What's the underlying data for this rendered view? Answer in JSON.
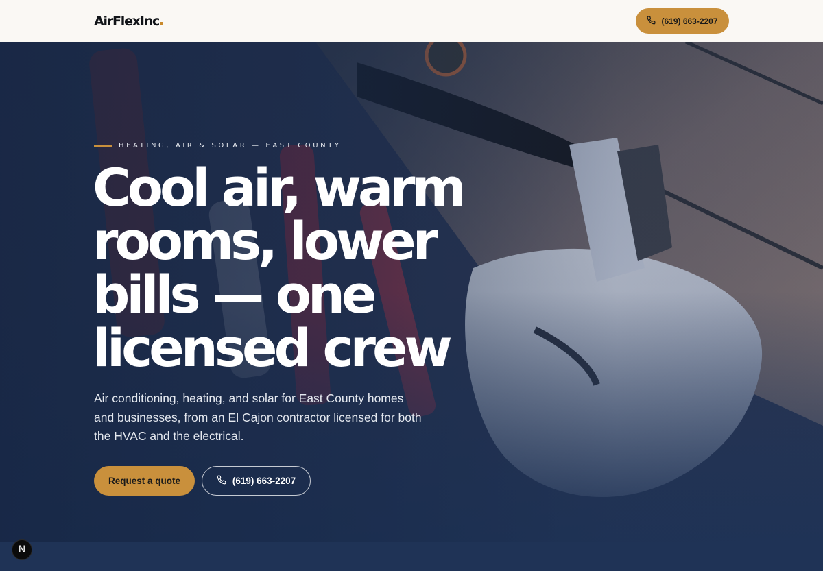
{
  "header": {
    "logo_text": "AirFlexInc",
    "phone_label": "(619) 663-2207",
    "phone_icon": "phone-icon"
  },
  "hero": {
    "eyebrow": "HEATING, AIR & SOLAR — EAST COUNTY",
    "headline_lines": [
      "Cool air, warm",
      "rooms, lower",
      "bills — one",
      "licensed crew"
    ],
    "subcopy": "Air conditioning, heating, and solar for East County homes and businesses, from an El Cajon contractor licensed for both the HVAC and the electrical.",
    "quote_button": "Request a quote",
    "phone_button": "(619) 663-2207",
    "background_image": "hvac-tools-and-work-gloves-photo"
  },
  "badge": {
    "letter": "N"
  },
  "colors": {
    "accent": "#c9903c",
    "header_bg": "#faf8f4",
    "hero_navy": "#1f3356"
  }
}
